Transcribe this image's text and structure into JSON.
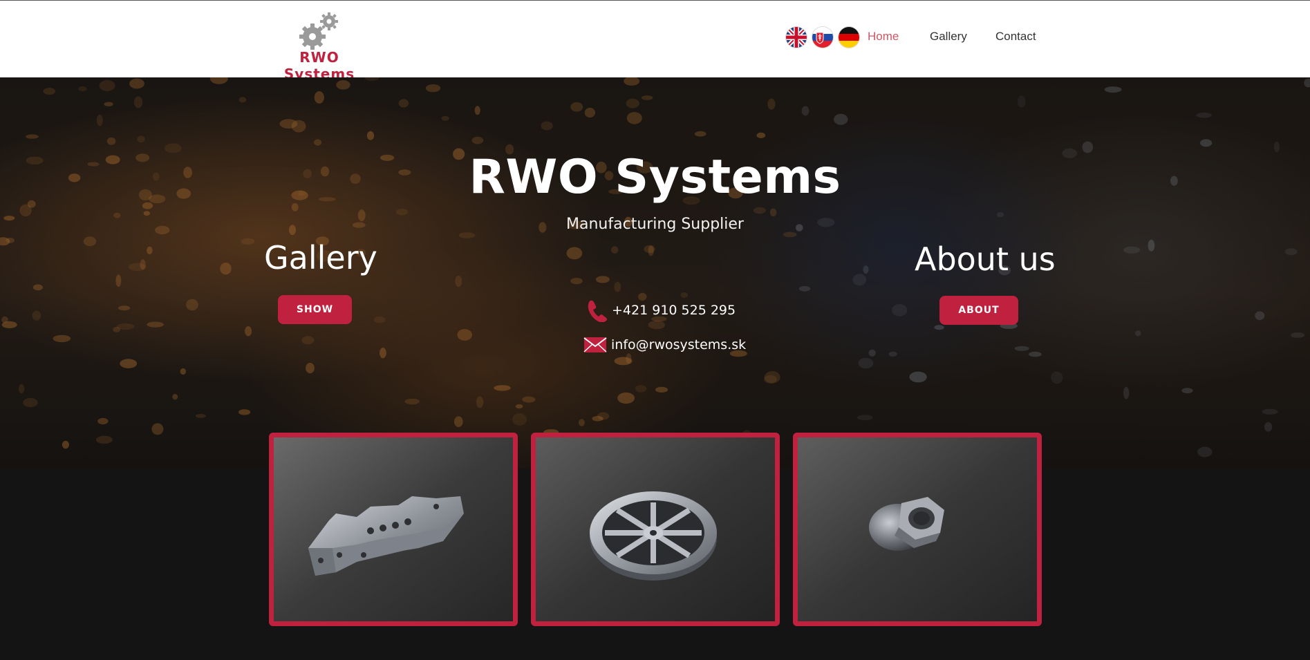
{
  "header": {
    "logo_text": "RWO Systems",
    "nav": [
      {
        "label": "Home",
        "active": true
      },
      {
        "label": "Gallery",
        "active": false
      },
      {
        "label": "Contact",
        "active": false
      }
    ],
    "languages": [
      "English",
      "Slovak",
      "German"
    ]
  },
  "hero": {
    "title": "RWO Systems",
    "subtitle": "Manufacturing Supplier",
    "gallery": {
      "heading": "Gallery",
      "button": "SHOW"
    },
    "about": {
      "heading": "About us",
      "button": "ABOUT"
    },
    "phone": "+421 910 525 295",
    "email": "info@rwosystems.sk"
  },
  "gallery_cards": [
    {
      "subject": "machined-bracket"
    },
    {
      "subject": "machined-wheel"
    },
    {
      "subject": "hex-cap-nut"
    }
  ],
  "colors": {
    "accent": "#c0213f",
    "nav_active": "#d05565",
    "footer_bg": "#141414"
  }
}
